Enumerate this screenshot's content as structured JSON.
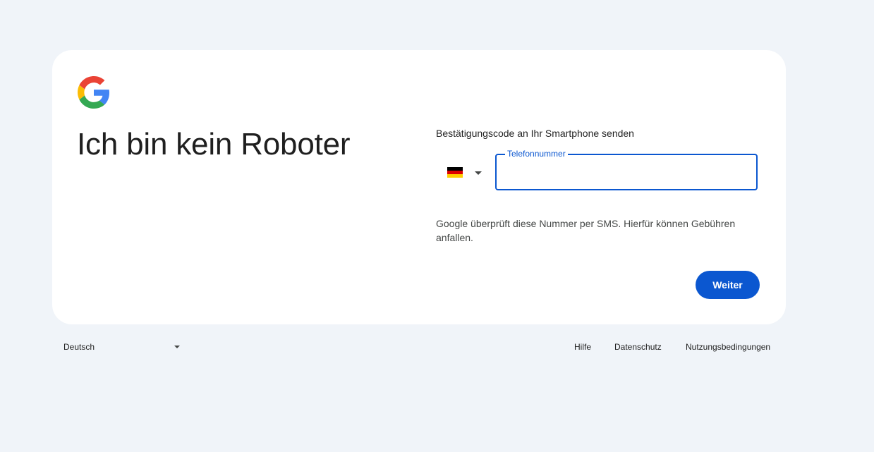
{
  "header": {
    "logo_icon": "google-g-logo-icon",
    "title": "Ich bin kein Roboter"
  },
  "verify": {
    "send_label": "Bestätigungscode an Ihr Smartphone senden",
    "country": {
      "flag_icon": "germany-flag-icon",
      "flag_colors": [
        "#000000",
        "#dd0000",
        "#ffce00"
      ]
    },
    "phone_field": {
      "label": "Telefonnummer",
      "value": ""
    },
    "note": "Google überprüft diese Nummer per SMS. Hierfür können Gebühren anfallen.",
    "next_label": "Weiter"
  },
  "footer": {
    "language": "Deutsch",
    "links": [
      "Hilfe",
      "Datenschutz",
      "Nutzungsbedingungen"
    ]
  },
  "colors": {
    "background": "#f0f4f9",
    "card": "#ffffff",
    "accent": "#0b57d0",
    "text": "#1f1f1f",
    "muted_text": "#444746"
  }
}
